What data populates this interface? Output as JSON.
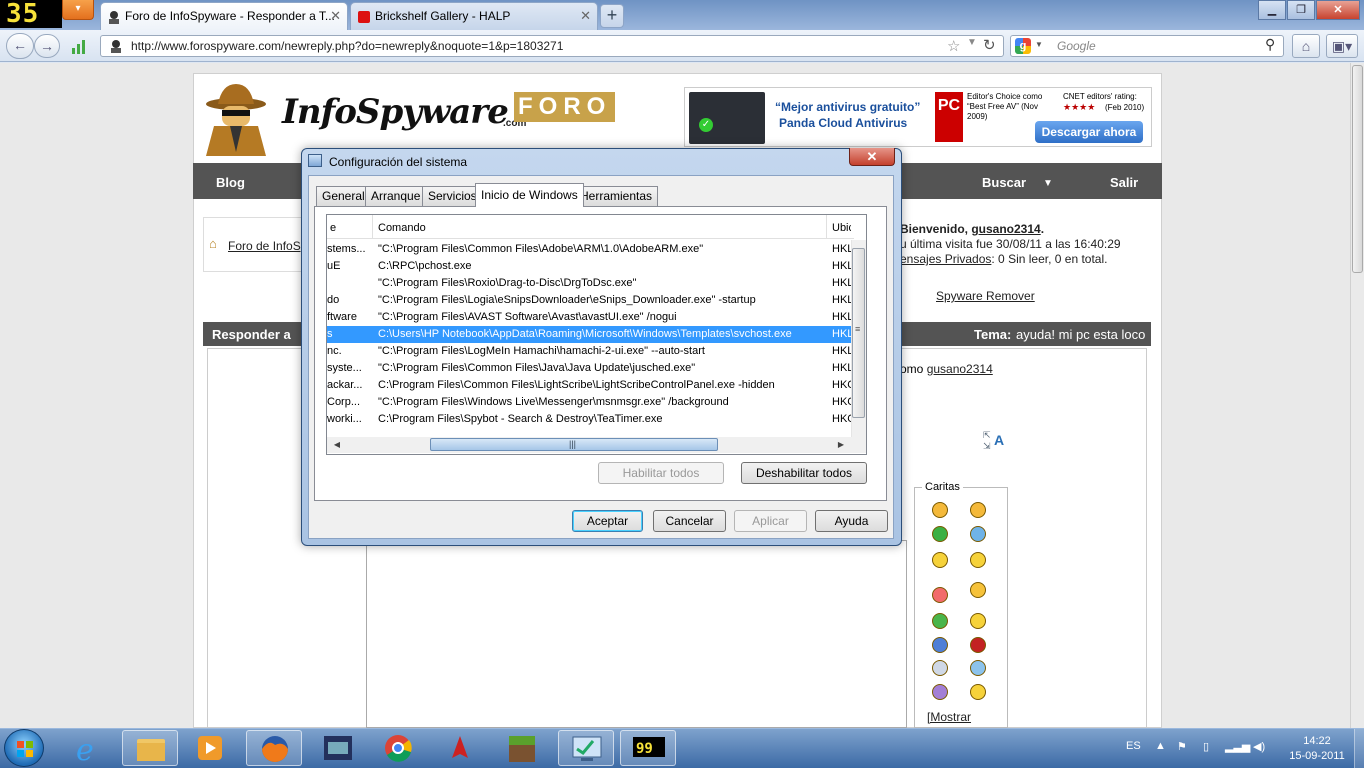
{
  "browser": {
    "counter": "35",
    "tabs": [
      {
        "title": "Foro de InfoSpyware - Responder a T..."
      },
      {
        "title": "Brickshelf Gallery - HALP"
      }
    ],
    "url": "http://www.forospyware.com/newreply.php?do=newreply&noquote=1&p=1803271",
    "search_placeholder": "Google"
  },
  "site": {
    "logo_text": "InfoSpyware",
    "logo_com": ".com",
    "logo_foro": "FORO",
    "ad": {
      "headline1": "“Mejor antivirus gratuito”",
      "headline2": "Panda Cloud Antivirus",
      "pcmag": "Editor's Choice como “Best Free AV” (Nov 2009)",
      "cnet": "CNET editors' rating:",
      "cnet_date": "(Feb 2010)",
      "button": "Descargar ahora"
    },
    "menu": {
      "blog": "Blog",
      "buscar": "Buscar",
      "salir": "Salir"
    },
    "breadcrumb": "Foro de InfoSp",
    "welcome": {
      "prefix": "Bienvenido, ",
      "user": "gusano2314",
      "last_visit": "u última visita fue 30/08/11 a las 16:40:29",
      "pm_link": "ensajes Privados",
      "pm_text": ": 0 Sin leer, 0 en total."
    },
    "spyware_remover": "Spyware Remover",
    "reply_title": "Responder a",
    "topic_label": "Tema:",
    "topic": "ayuda! mi pc esta loco",
    "posting_as_prefix": "omo ",
    "posting_as_user": "gusano2314",
    "caritas_label": "Caritas",
    "mostrar": "[Mostrar"
  },
  "dialog": {
    "title": "Configuración del sistema",
    "tabs": [
      "General",
      "Arranque",
      "Servicios",
      "Inicio de Windows",
      "Herramientas"
    ],
    "columns": {
      "first": "e",
      "command": "Comando",
      "location": "Ubic"
    },
    "rows": [
      {
        "name": "stems...",
        "command": "\"C:\\Program Files\\Common Files\\Adobe\\ARM\\1.0\\AdobeARM.exe\"",
        "loc": "HKL"
      },
      {
        "name": "uE",
        "command": "C:\\RPC\\pchost.exe",
        "loc": "HKL"
      },
      {
        "name": "",
        "command": "\"C:\\Program Files\\Roxio\\Drag-to-Disc\\DrgToDsc.exe\"",
        "loc": "HKL"
      },
      {
        "name": "do",
        "command": "\"C:\\Program Files\\Logia\\eSnipsDownloader\\eSnips_Downloader.exe\" -startup",
        "loc": "HKL"
      },
      {
        "name": "ftware",
        "command": "\"C:\\Program Files\\AVAST Software\\Avast\\avastUI.exe\" /nogui",
        "loc": "HKL"
      },
      {
        "name": "s",
        "command": "C:\\Users\\HP Notebook\\AppData\\Roaming\\Microsoft\\Windows\\Templates\\svchost.exe",
        "loc": "HKL"
      },
      {
        "name": "nc.",
        "command": "\"C:\\Program Files\\LogMeIn Hamachi\\hamachi-2-ui.exe\" --auto-start",
        "loc": "HKL"
      },
      {
        "name": "syste...",
        "command": "\"C:\\Program Files\\Common Files\\Java\\Java Update\\jusched.exe\"",
        "loc": "HKL"
      },
      {
        "name": "ackar...",
        "command": "C:\\Program Files\\Common Files\\LightScribe\\LightScribeControlPanel.exe -hidden",
        "loc": "HKC"
      },
      {
        "name": "Corp...",
        "command": "\"C:\\Program Files\\Windows Live\\Messenger\\msnmsgr.exe\" /background",
        "loc": "HKC"
      },
      {
        "name": "worki...",
        "command": "C:\\Program Files\\Spybot - Search & Destroy\\TeaTimer.exe",
        "loc": "HKC"
      }
    ],
    "selected_row": 5,
    "enable_all": "Habilitar todos",
    "disable_all": "Deshabilitar todos",
    "ok": "Aceptar",
    "cancel": "Cancelar",
    "apply": "Aplicar",
    "help": "Ayuda"
  },
  "taskbar": {
    "language": "ES",
    "time": "14:22",
    "date": "15-09-2011",
    "apps": [
      "ie",
      "explorer",
      "media-player",
      "firefox",
      "game",
      "chrome",
      "rocket",
      "minecraft",
      "msconfig",
      "counter-app"
    ]
  },
  "colors": {
    "accent": "#3399ff",
    "menubar": "#545454",
    "foro": "#c8a24a"
  }
}
